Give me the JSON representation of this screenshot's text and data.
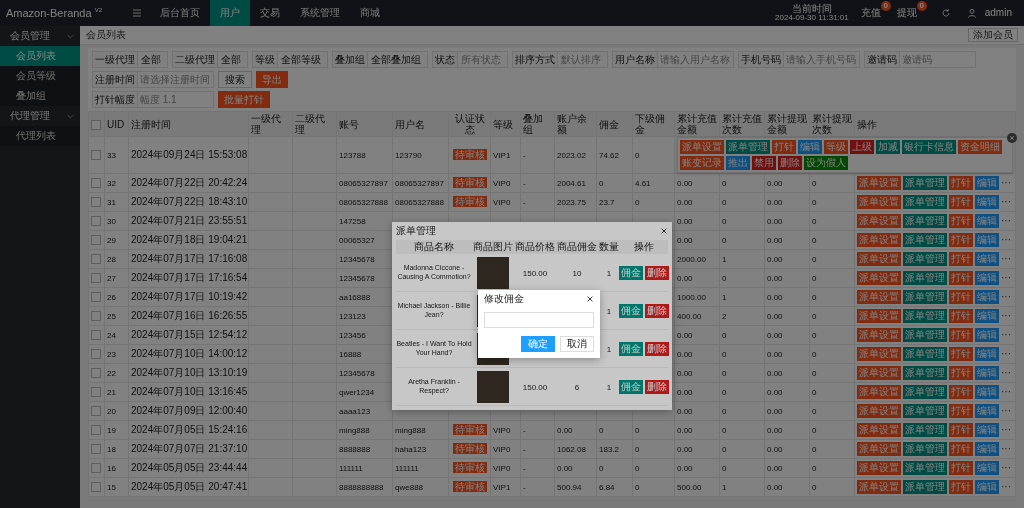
{
  "topbar": {
    "logo": "Amazon-Beranda $^{V2}$",
    "nav": [
      {
        "label": "后台首页",
        "selected": false
      },
      {
        "label": "用户",
        "selected": true
      },
      {
        "label": "交易",
        "selected": false
      },
      {
        "label": "系统管理",
        "selected": false
      },
      {
        "label": "商城",
        "selected": false
      }
    ],
    "clock_label": "当前时间",
    "clock_time": "2024-09-30 11:31:01",
    "alerts": [
      {
        "label": "充值",
        "count": "0"
      },
      {
        "label": "提现",
        "count": "0"
      }
    ],
    "user": "admin"
  },
  "sidebar": {
    "groups": [
      {
        "label": "会员管理",
        "expanded": true,
        "children": [
          {
            "label": "会员列表",
            "selected": true
          },
          {
            "label": "会员等级",
            "selected": false
          },
          {
            "label": "叠加组",
            "selected": false
          }
        ]
      },
      {
        "label": "代理管理",
        "expanded": true,
        "children": [
          {
            "label": "代理列表",
            "selected": false
          }
        ]
      }
    ]
  },
  "page_tab": "会员列表",
  "add_button": "添加会员",
  "filter_rows": [
    [
      {
        "kind": "select",
        "label": "一级代理",
        "value": "全部"
      },
      {
        "kind": "select",
        "label": "二级代理",
        "value": "全部"
      },
      {
        "kind": "select",
        "label": "等级",
        "value": "全部等级"
      },
      {
        "kind": "select",
        "label": "叠加组",
        "value": "全部叠加组"
      },
      {
        "kind": "select",
        "label": "状态",
        "placeholder": "所有状态"
      },
      {
        "kind": "select",
        "label": "排序方式",
        "placeholder": "默认排序"
      },
      {
        "kind": "input",
        "label": "用户名称",
        "placeholder": "请输入用户名称"
      },
      {
        "kind": "input",
        "label": "手机号码",
        "placeholder": "请输入手机号码"
      },
      {
        "kind": "input",
        "label": "邀请码",
        "placeholder": "邀请码"
      }
    ],
    [
      {
        "kind": "input",
        "label": "注册时间",
        "placeholder": "请选择注册时间"
      },
      {
        "kind": "search_button",
        "label": "搜索"
      },
      {
        "kind": "export_button",
        "label": "导出"
      }
    ],
    [
      {
        "kind": "input",
        "label": "打针幅度",
        "placeholder": "幅度 1.1"
      },
      {
        "kind": "button",
        "label": "批量打针"
      }
    ]
  ],
  "table": {
    "select_all": {
      "checked": false
    },
    "actions_label": "操作",
    "columns": [
      {
        "label": "UID",
        "kind": "text"
      },
      {
        "label": "注册时间",
        "kind": "text"
      },
      {
        "label": "一级代理",
        "kind": "text"
      },
      {
        "label": "二级代理",
        "kind": "text"
      },
      {
        "label": "账号",
        "kind": "text"
      },
      {
        "label": "用户名",
        "kind": "text"
      },
      {
        "label": "认证状态",
        "kind": "badge"
      },
      {
        "label": "等级",
        "kind": "text"
      },
      {
        "label": "叠加组",
        "kind": "text"
      },
      {
        "label": "账户余额",
        "kind": "text"
      },
      {
        "label": "佣金",
        "kind": "text"
      },
      {
        "label": "下级佣金",
        "kind": "text"
      },
      {
        "label": "累计充值金额",
        "kind": "text"
      },
      {
        "label": "累计充值次数",
        "kind": "text"
      },
      {
        "label": "累计提现金额",
        "kind": "text"
      },
      {
        "label": "累计提现次数",
        "kind": "text"
      }
    ],
    "rows": [
      {
        "checked": false,
        "expanded": true,
        "cells": [
          "33",
          "2024年09月24日 15:53:08",
          null,
          null,
          "123788",
          "123790",
          "待审核",
          "VIP1",
          "-",
          "2023.02",
          "74.62",
          "0"
        ],
        "actions": [
          {
            "label": "派单设置",
            "kind": "warm"
          },
          {
            "label": "派单管理",
            "kind": "primary"
          },
          {
            "label": "打针",
            "kind": "warm"
          },
          {
            "label": "编辑",
            "kind": "normal"
          },
          {
            "label": "等级",
            "kind": "warm"
          },
          {
            "label": "上级",
            "kind": "danger"
          },
          {
            "label": "加减",
            "kind": "primary"
          },
          {
            "label": "银行卡信息",
            "kind": "primary"
          },
          {
            "label": "资金明细",
            "kind": "warm"
          },
          {
            "label": "账变记录",
            "kind": "warm"
          },
          {
            "label": "推出",
            "kind": "normal"
          },
          {
            "label": "禁用",
            "kind": "danger"
          },
          {
            "label": "删除",
            "kind": "danger"
          },
          {
            "label": "设为假人",
            "kind": "success"
          }
        ]
      },
      {
        "checked": false,
        "expanded": false,
        "cells": [
          "32",
          "2024年07月22日 20:42:24",
          null,
          null,
          "08065327897",
          "08065327897",
          "待审核",
          "VIP0",
          "-",
          "2004.61",
          "0",
          "4.61",
          "0.00",
          "0",
          "0.00",
          "0"
        ],
        "actions": [
          {
            "label": "派单设置",
            "kind": "warm"
          },
          {
            "label": "派单管理",
            "kind": "primary"
          },
          {
            "label": "打针",
            "kind": "warm"
          },
          {
            "label": "编辑",
            "kind": "normal"
          }
        ],
        "more": "···"
      },
      {
        "checked": false,
        "expanded": false,
        "cells": [
          "31",
          "2024年07月22日 18:43:10",
          null,
          null,
          "08065327888",
          "08065327888",
          "待审核",
          "VIP0",
          "-",
          "2023.75",
          "23.7",
          "0",
          "0.00",
          "0",
          "0.00",
          "0"
        ],
        "actions": [
          {
            "label": "派单设置",
            "kind": "warm"
          },
          {
            "label": "派单管理",
            "kind": "primary"
          },
          {
            "label": "打针",
            "kind": "warm"
          },
          {
            "label": "编辑",
            "kind": "normal"
          }
        ],
        "more": "···"
      },
      {
        "checked": false,
        "expanded": false,
        "cells": [
          "30",
          "2024年07月21日 23:55:51",
          null,
          null,
          "147258",
          null,
          null,
          null,
          null,
          null,
          null,
          null,
          "0.00",
          "0",
          "0.00",
          "0"
        ],
        "actions": [
          {
            "label": "派单设置",
            "kind": "warm"
          },
          {
            "label": "派单管理",
            "kind": "primary"
          },
          {
            "label": "打针",
            "kind": "warm"
          },
          {
            "label": "编辑",
            "kind": "normal"
          }
        ],
        "more": "···"
      },
      {
        "checked": false,
        "expanded": false,
        "cells": [
          "29",
          "2024年07月18日 19:04:21",
          null,
          null,
          "00065327",
          null,
          null,
          null,
          null,
          null,
          null,
          null,
          "0.00",
          "0",
          "0.00",
          "0"
        ],
        "actions": [
          {
            "label": "派单设置",
            "kind": "warm"
          },
          {
            "label": "派单管理",
            "kind": "primary"
          },
          {
            "label": "打针",
            "kind": "warm"
          },
          {
            "label": "编辑",
            "kind": "normal"
          }
        ],
        "more": "···"
      },
      {
        "checked": false,
        "expanded": false,
        "cells": [
          "28",
          "2024年07月17日 17:16:08",
          null,
          null,
          "12345678",
          null,
          null,
          null,
          null,
          null,
          null,
          null,
          "2000.00",
          "1",
          "0.00",
          "0"
        ],
        "actions": [
          {
            "label": "派单设置",
            "kind": "warm"
          },
          {
            "label": "派单管理",
            "kind": "primary"
          },
          {
            "label": "打针",
            "kind": "warm"
          },
          {
            "label": "编辑",
            "kind": "normal"
          }
        ],
        "more": "···"
      },
      {
        "checked": false,
        "expanded": false,
        "cells": [
          "27",
          "2024年07月17日 17:16:54",
          null,
          null,
          "12345678",
          null,
          null,
          null,
          null,
          null,
          null,
          null,
          "0.00",
          "0",
          "0.00",
          "0"
        ],
        "actions": [
          {
            "label": "派单设置",
            "kind": "warm"
          },
          {
            "label": "派单管理",
            "kind": "primary"
          },
          {
            "label": "打针",
            "kind": "warm"
          },
          {
            "label": "编辑",
            "kind": "normal"
          }
        ],
        "more": "···"
      },
      {
        "checked": false,
        "expanded": false,
        "cells": [
          "26",
          "2024年07月17日 10:19:42",
          null,
          null,
          "aa16888",
          null,
          null,
          null,
          null,
          null,
          null,
          null,
          "1000.00",
          "1",
          "0.00",
          "0"
        ],
        "actions": [
          {
            "label": "派单设置",
            "kind": "warm"
          },
          {
            "label": "派单管理",
            "kind": "primary"
          },
          {
            "label": "打针",
            "kind": "warm"
          },
          {
            "label": "编辑",
            "kind": "normal"
          }
        ],
        "more": "···"
      },
      {
        "checked": false,
        "expanded": false,
        "cells": [
          "25",
          "2024年07月16日 16:26:55",
          null,
          null,
          "123123",
          null,
          null,
          null,
          null,
          null,
          null,
          null,
          "400.00",
          "2",
          "0.00",
          "0"
        ],
        "actions": [
          {
            "label": "派单设置",
            "kind": "warm"
          },
          {
            "label": "派单管理",
            "kind": "primary"
          },
          {
            "label": "打针",
            "kind": "warm"
          },
          {
            "label": "编辑",
            "kind": "normal"
          }
        ],
        "more": "···"
      },
      {
        "checked": false,
        "expanded": false,
        "cells": [
          "24",
          "2024年07月15日 12:54:12",
          null,
          null,
          "123456",
          null,
          null,
          null,
          null,
          null,
          null,
          null,
          "0.00",
          "0",
          "0.00",
          "0"
        ],
        "actions": [
          {
            "label": "派单设置",
            "kind": "warm"
          },
          {
            "label": "派单管理",
            "kind": "primary"
          },
          {
            "label": "打针",
            "kind": "warm"
          },
          {
            "label": "编辑",
            "kind": "normal"
          }
        ],
        "more": "···"
      },
      {
        "checked": false,
        "expanded": false,
        "cells": [
          "23",
          "2024年07月10日 14:00:12",
          null,
          null,
          "16888",
          null,
          null,
          null,
          null,
          null,
          null,
          null,
          "0.00",
          "0",
          "0.00",
          "0"
        ],
        "actions": [
          {
            "label": "派单设置",
            "kind": "warm"
          },
          {
            "label": "派单管理",
            "kind": "primary"
          },
          {
            "label": "打针",
            "kind": "warm"
          },
          {
            "label": "编辑",
            "kind": "normal"
          }
        ],
        "more": "···"
      },
      {
        "checked": false,
        "expanded": false,
        "cells": [
          "22",
          "2024年07月10日 13:10:19",
          null,
          null,
          "12345678",
          null,
          null,
          null,
          null,
          null,
          null,
          null,
          "0.00",
          "0",
          "0.00",
          "0"
        ],
        "actions": [
          {
            "label": "派单设置",
            "kind": "warm"
          },
          {
            "label": "派单管理",
            "kind": "primary"
          },
          {
            "label": "打针",
            "kind": "warm"
          },
          {
            "label": "编辑",
            "kind": "normal"
          }
        ],
        "more": "···"
      },
      {
        "checked": false,
        "expanded": false,
        "cells": [
          "21",
          "2024年07月10日 13:16:45",
          null,
          null,
          "qwer1234",
          null,
          null,
          null,
          null,
          null,
          null,
          null,
          "0.00",
          "0",
          "0.00",
          "0"
        ],
        "actions": [
          {
            "label": "派单设置",
            "kind": "warm"
          },
          {
            "label": "派单管理",
            "kind": "primary"
          },
          {
            "label": "打针",
            "kind": "warm"
          },
          {
            "label": "编辑",
            "kind": "normal"
          }
        ],
        "more": "···"
      },
      {
        "checked": false,
        "expanded": false,
        "cells": [
          "20",
          "2024年07月09日 12:00:40",
          null,
          null,
          "aaaa123",
          null,
          null,
          null,
          null,
          null,
          null,
          null,
          "0.00",
          "0",
          "0.00",
          "0"
        ],
        "actions": [
          {
            "label": "派单设置",
            "kind": "warm"
          },
          {
            "label": "派单管理",
            "kind": "primary"
          },
          {
            "label": "打针",
            "kind": "warm"
          },
          {
            "label": "编辑",
            "kind": "normal"
          }
        ],
        "more": "···"
      },
      {
        "checked": false,
        "expanded": false,
        "cells": [
          "19",
          "2024年07月05日 15:24:16",
          null,
          null,
          "ming888",
          "ming888",
          "待审核",
          "VIP0",
          "-",
          "0.00",
          "0",
          "0",
          "0.00",
          "0",
          "0.00",
          "0"
        ],
        "actions": [
          {
            "label": "派单设置",
            "kind": "warm"
          },
          {
            "label": "派单管理",
            "kind": "primary"
          },
          {
            "label": "打针",
            "kind": "warm"
          },
          {
            "label": "编辑",
            "kind": "normal"
          }
        ],
        "more": "···"
      },
      {
        "checked": false,
        "expanded": false,
        "cells": [
          "18",
          "2024年07月07日 21:37:10",
          null,
          null,
          "8888888",
          "haha123",
          "待审核",
          "VIP0",
          "-",
          "1062.08",
          "183.2",
          "0",
          "0.00",
          "0",
          "0.00",
          "0"
        ],
        "actions": [
          {
            "label": "派单设置",
            "kind": "warm"
          },
          {
            "label": "派单管理",
            "kind": "primary"
          },
          {
            "label": "打针",
            "kind": "warm"
          },
          {
            "label": "编辑",
            "kind": "normal"
          }
        ],
        "more": "···"
      },
      {
        "checked": false,
        "expanded": false,
        "cells": [
          "16",
          "2024年05月05日 23:44:44",
          null,
          null,
          "111111",
          "111111",
          "待审核",
          "VIP0",
          "-",
          "0.00",
          "0",
          "0",
          "0.00",
          "0",
          "0.00",
          "0"
        ],
        "actions": [
          {
            "label": "派单设置",
            "kind": "warm"
          },
          {
            "label": "派单管理",
            "kind": "primary"
          },
          {
            "label": "打针",
            "kind": "warm"
          },
          {
            "label": "编辑",
            "kind": "normal"
          }
        ],
        "more": "···"
      },
      {
        "checked": false,
        "expanded": false,
        "cells": [
          "15",
          "2024年05月05日 20:47:41",
          null,
          null,
          "8888888888",
          "qwe888",
          "待审核",
          "VIP1",
          "-",
          "500.94",
          "6.84",
          "0",
          "500.00",
          "1",
          "0.00",
          "0"
        ],
        "actions": [
          {
            "label": "派单设置",
            "kind": "warm"
          },
          {
            "label": "派单管理",
            "kind": "primary"
          },
          {
            "label": "打针",
            "kind": "warm"
          },
          {
            "label": "编辑",
            "kind": "normal"
          }
        ],
        "more": "···"
      }
    ]
  },
  "modal": {
    "title": "派单管理",
    "columns": [
      "商品名称",
      "商品图片",
      "商品价格",
      "商品佣金",
      "数量",
      "操作"
    ],
    "rows": [
      {
        "name": "Madonna Ciccone - Causing A Commotion?",
        "price": "150.00",
        "commission": "10",
        "quantity": "1",
        "actions": [
          {
            "label": "佣金",
            "kind": "primary"
          },
          {
            "label": "删除",
            "kind": "danger"
          }
        ]
      },
      {
        "name": "Michael Jackson - Billie Jean?",
        "quantity": "1",
        "actions": [
          {
            "label": "佣金",
            "kind": "primary"
          },
          {
            "label": "删除",
            "kind": "danger"
          }
        ]
      },
      {
        "name": "Beatles - I Want To Hold Your Hand?",
        "quantity": "1",
        "actions": [
          {
            "label": "佣金",
            "kind": "primary"
          },
          {
            "label": "删除",
            "kind": "danger"
          }
        ]
      },
      {
        "name": "Aretha Franklin - Respect?",
        "price": "150.00",
        "commission": "6",
        "quantity": "1",
        "actions": [
          {
            "label": "佣金",
            "kind": "primary"
          },
          {
            "label": "删除",
            "kind": "danger"
          }
        ]
      }
    ]
  },
  "dialog": {
    "title": "修改佣金",
    "buttons": [
      {
        "label": "确定",
        "kind": "primary"
      },
      {
        "label": "取消",
        "kind": "plain"
      }
    ]
  }
}
